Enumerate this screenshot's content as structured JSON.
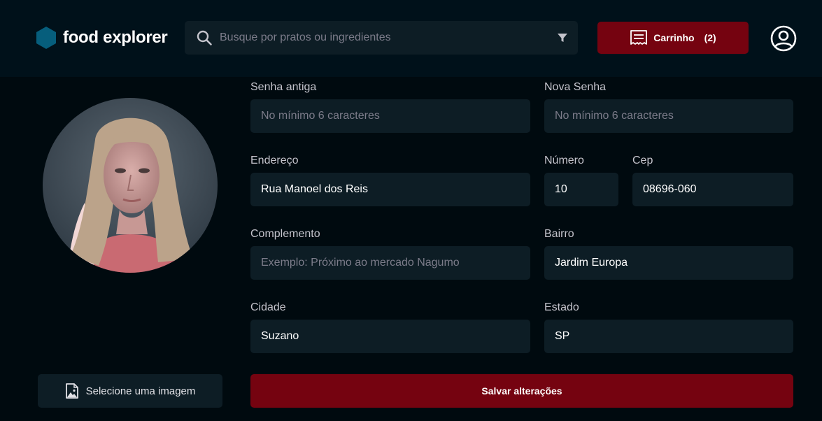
{
  "brand": {
    "name": "food explorer",
    "icon": "hexagon-logo-icon",
    "color": "#065E7C"
  },
  "search": {
    "placeholder": "Busque por pratos ou ingredientes",
    "value": ""
  },
  "cart": {
    "label": "Carrinho",
    "count": "(2)",
    "icon": "receipt-icon"
  },
  "profile": {
    "icon": "user-circle-icon"
  },
  "colors": {
    "background": "#000A0F",
    "header": "#00111A",
    "input": "#0D1D25",
    "accent": "#750310",
    "placeholder": "#7C7C8A"
  },
  "form": {
    "old_password": {
      "label": "Senha antiga",
      "placeholder": "No mínimo 6 caracteres",
      "value": ""
    },
    "new_password": {
      "label": "Nova Senha",
      "placeholder": "No mínimo 6 caracteres",
      "value": ""
    },
    "address": {
      "label": "Endereço",
      "value": "Rua Manoel dos Reis"
    },
    "number": {
      "label": "Número",
      "value": "10"
    },
    "cep": {
      "label": "Cep",
      "value": "08696-060"
    },
    "complement": {
      "label": "Complemento",
      "placeholder": "Exemplo: Próximo ao mercado Nagumo",
      "value": ""
    },
    "neighborhood": {
      "label": "Bairro",
      "value": "Jardim Europa"
    },
    "city": {
      "label": "Cidade",
      "value": "Suzano"
    },
    "state": {
      "label": "Estado",
      "value": "SP"
    }
  },
  "actions": {
    "select_image": "Selecione uma imagem",
    "save": "Salvar alterações"
  }
}
